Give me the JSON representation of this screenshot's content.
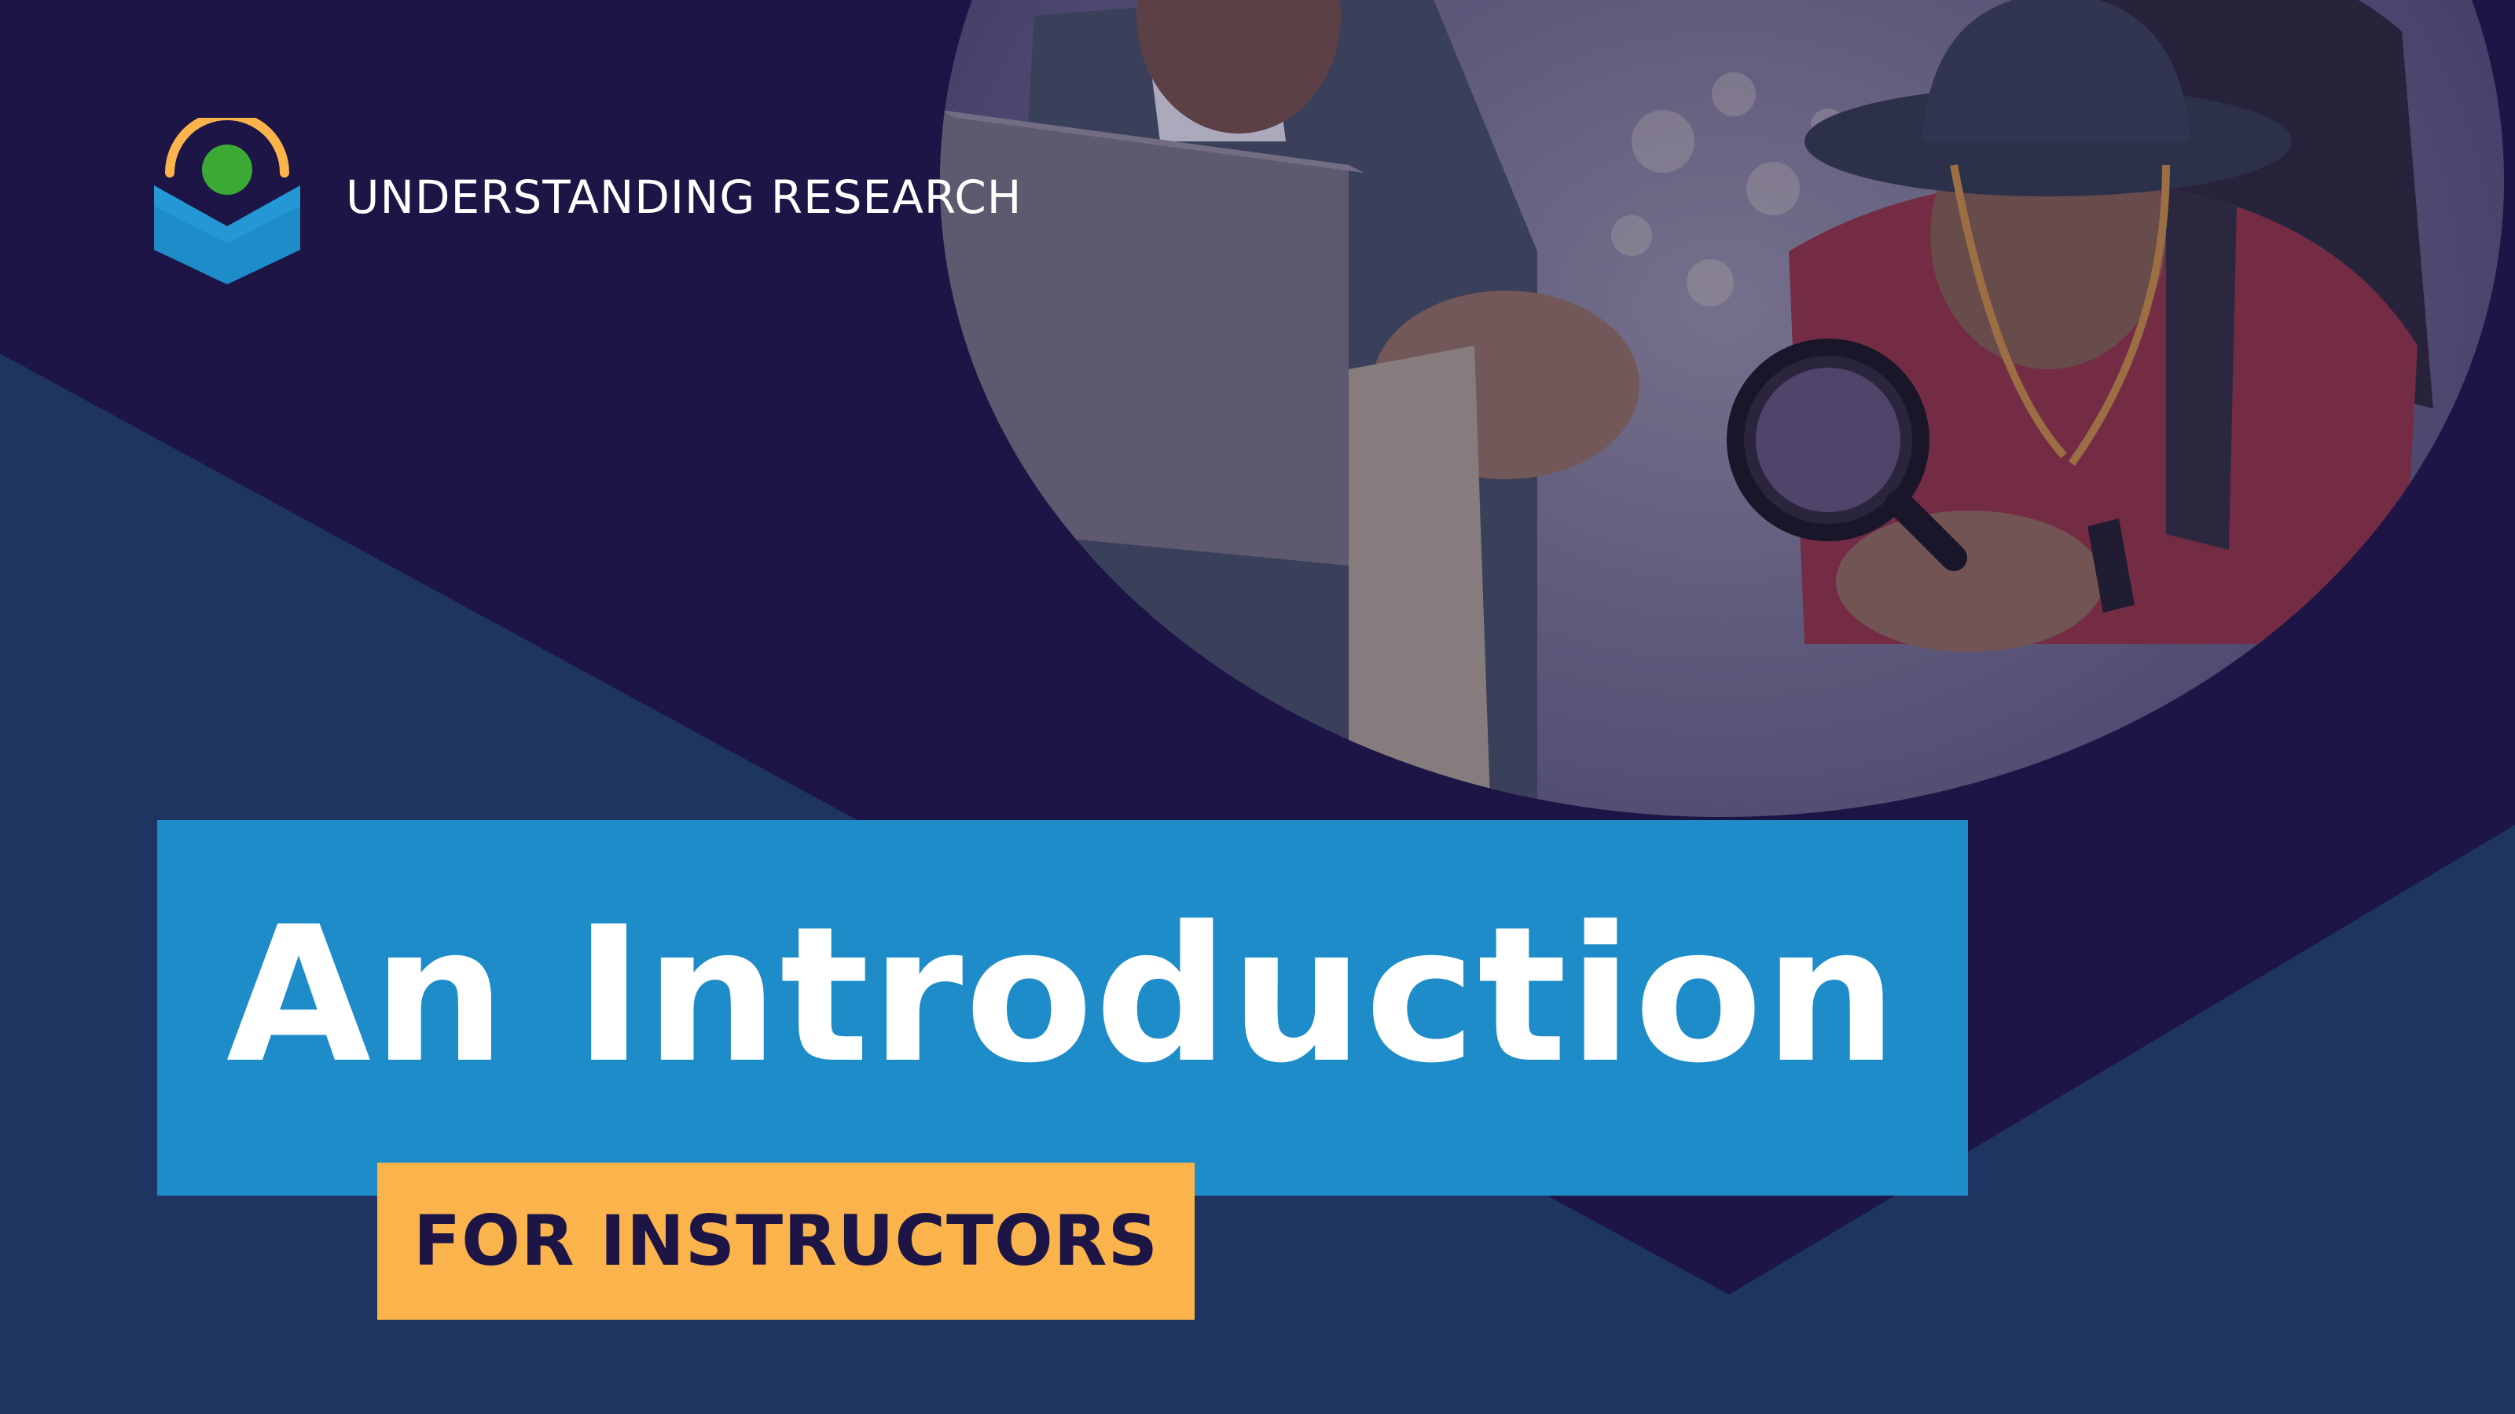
{
  "brand": {
    "name": "UNDERSTANDING RESEARCH",
    "logo_icon": "book-eye-logo-icon"
  },
  "hero": {
    "title": "An Introduction",
    "tagline": "FOR INSTRUCTORS",
    "photo_icon": "researchers-magnifying-glass-photo"
  },
  "colors": {
    "background": "#1d1545",
    "lower_band": "#1e3461",
    "title_box": "#1e8cc8",
    "tag_box": "#fbb44c",
    "logo_arc": "#fbb44c",
    "logo_dot": "#3aaa35",
    "logo_book": "#1e8cc8"
  }
}
